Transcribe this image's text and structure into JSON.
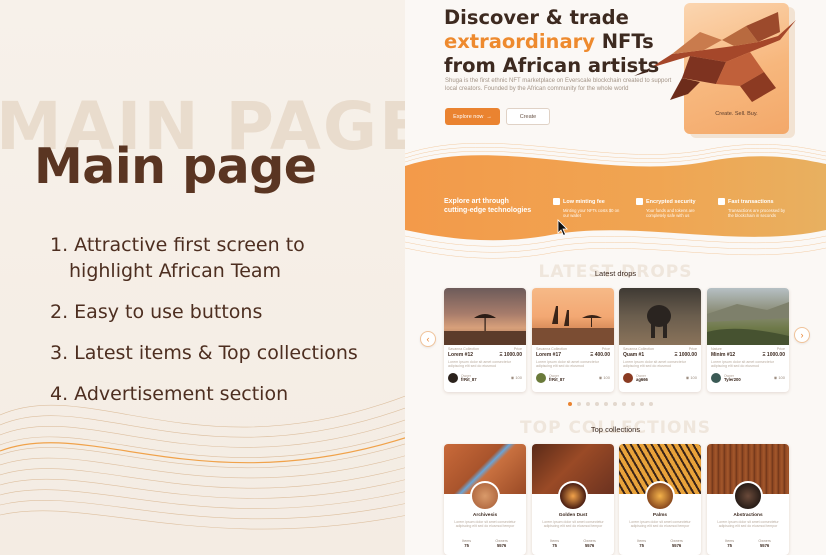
{
  "slide": {
    "background_word": "MAIN PAGE",
    "title": "Main page",
    "points": [
      {
        "line1": "1. Attractive first screen to",
        "line2": "highlight African Team"
      },
      {
        "line1": "2. Easy to use buttons",
        "line2": ""
      },
      {
        "line1": "3. Latest items & Top collections",
        "line2": ""
      },
      {
        "line1": "4. Advertisement section",
        "line2": ""
      }
    ]
  },
  "hero": {
    "title_line1": "Discover & trade",
    "title_highlight": "extraordinary",
    "title_line2_rest": " NFTs",
    "title_line3": "from African artists",
    "description": "Shuga is the first ethnic NFT marketplace on Everscale blockchain created to support local creators. Founded by the African community for the whole world",
    "explore_button": "Explore now",
    "create_button": "Create",
    "card_text": "Create. Sell. Buy."
  },
  "features": {
    "headline_line1": "Explore art through",
    "headline_line2": "cutting-edge technologies",
    "items": [
      {
        "title": "Low minting fee",
        "desc": "Minting your NFTs costs $0 on our wallet",
        "icon": "home-icon"
      },
      {
        "title": "Encrypted security",
        "desc": "Your funds and tokens are completely safe with us",
        "icon": "shield-icon"
      },
      {
        "title": "Fast transactions",
        "desc": "Transactions are processed by the blockchain in seconds",
        "icon": "lightning-icon"
      }
    ]
  },
  "latest_drops": {
    "ghost": "LATEST DROPS",
    "title": "Latest drops",
    "cards": [
      {
        "collection": "Savanna Collection",
        "price_label": "Price",
        "name": "Lorem #12",
        "price": "Ξ 1000.00",
        "desc": "Lorem ipsum dolor sit amet consectetur adipiscing elit sed do eiusmod",
        "owner_label": "Owner",
        "owner": "frRit_87",
        "likes": "100"
      },
      {
        "collection": "Savanna Collection",
        "price_label": "Price",
        "name": "Lorem #17",
        "price": "Ξ 400.00",
        "desc": "Lorem ipsum dolor sit amet consectetur adipiscing elit sed do eiusmod",
        "owner_label": "Owner",
        "owner": "frRit_87",
        "likes": "100"
      },
      {
        "collection": "Savanna Collection",
        "price_label": "Price",
        "name": "Quam #1",
        "price": "Ξ 1000.00",
        "desc": "Lorem ipsum dolor sit amet consectetur adipiscing elit sed do eiusmod",
        "owner_label": "Owner",
        "owner": "ag666",
        "likes": "100"
      },
      {
        "collection": "Nature",
        "price_label": "Price",
        "name": "Minim #12",
        "price": "Ξ 1000.00",
        "desc": "Lorem ipsum dolor sit amet consectetur adipiscing elit sed do eiusmod",
        "owner_label": "Owner",
        "owner": "Tyler200",
        "likes": "100"
      }
    ],
    "dots_count": 10,
    "active_dot": 0
  },
  "top_collections": {
    "ghost": "TOP COLLECTIONS",
    "title": "Top collections",
    "items": [
      {
        "name": "Archivesis",
        "desc": "Lorem ipsum dolor sit amet consectetur adipiscing elit sed do eiusmod tempor",
        "items_label": "Items",
        "items": "75",
        "owners_label": "Owners",
        "owners": "5576"
      },
      {
        "name": "Golden Dust",
        "desc": "Lorem ipsum dolor sit amet consectetur adipiscing elit sed do eiusmod tempor",
        "items_label": "Items",
        "items": "75",
        "owners_label": "Owners",
        "owners": "5576"
      },
      {
        "name": "Palms",
        "desc": "Lorem ipsum dolor sit amet consectetur adipiscing elit sed do eiusmod tempor",
        "items_label": "Items",
        "items": "75",
        "owners_label": "Owners",
        "owners": "5576"
      },
      {
        "name": "Abstractions",
        "desc": "Lorem ipsum dolor sit amet consectetur adipiscing elit sed do eiusmod tempor",
        "items_label": "Items",
        "items": "75",
        "owners_label": "Owners",
        "owners": "5576"
      }
    ]
  },
  "colors": {
    "accent": "#ea8330",
    "brown_dark": "#5a3522",
    "background": "#f6efe8"
  }
}
